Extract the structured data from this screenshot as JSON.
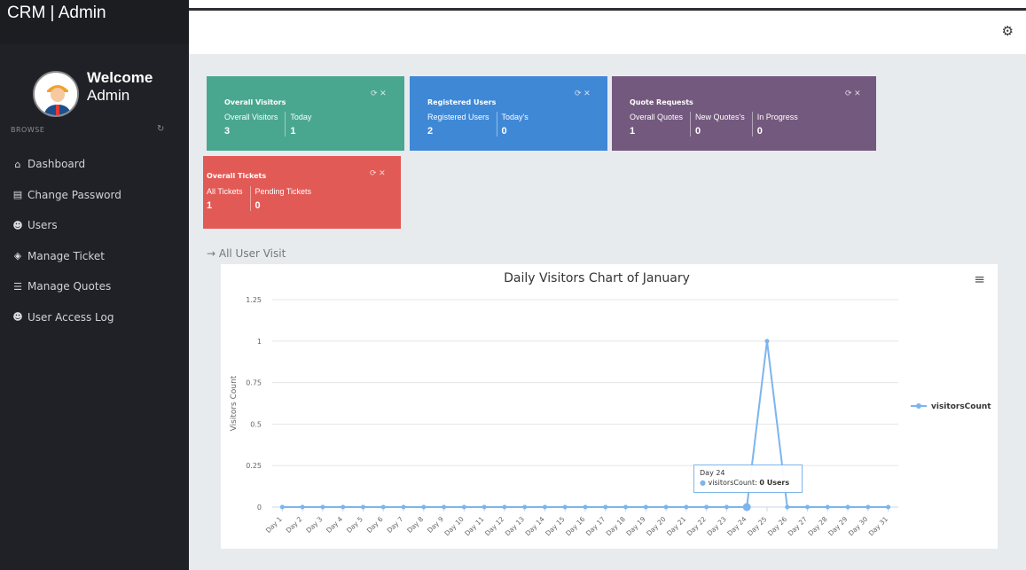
{
  "app": {
    "title": "CRM | Admin"
  },
  "profile": {
    "welcome": "Welcome",
    "name": "Admin"
  },
  "sidebar": {
    "browse": "BROWSE",
    "items": [
      {
        "label": "Dashboard",
        "icon": "home-icon"
      },
      {
        "label": "Change Password",
        "icon": "file-icon"
      },
      {
        "label": "Users",
        "icon": "users-icon"
      },
      {
        "label": "Manage Ticket",
        "icon": "ticket-icon"
      },
      {
        "label": "Manage Quotes",
        "icon": "list-icon"
      },
      {
        "label": "User Access Log",
        "icon": "users-icon"
      }
    ]
  },
  "stats": {
    "visitors": {
      "title": "Overall Visitors",
      "labels": [
        "Overall Visitors",
        "Today"
      ],
      "values": [
        "3",
        "1"
      ],
      "color": "#4aa78f"
    },
    "registered": {
      "title": "Registered Users",
      "labels": [
        "Registered Users",
        "Today's"
      ],
      "values": [
        "2",
        "0"
      ],
      "color": "#3f88d6"
    },
    "quotes": {
      "title": "Quote Requests",
      "labels": [
        "Overall Quotes",
        "New Quotes's",
        "In Progress"
      ],
      "values": [
        "1",
        "0",
        "0"
      ],
      "color": "#74597e"
    },
    "tickets": {
      "title": "Overall Tickets",
      "labels": [
        "All Tickets",
        "Pending Tickets"
      ],
      "values": [
        "1",
        "0"
      ],
      "color": "#e25a56"
    }
  },
  "section": {
    "link": "→ All User Visit"
  },
  "chart_data": {
    "type": "line",
    "title": "Daily Visitors Chart of January",
    "ylabel": "Visitors Count",
    "xlabel": "",
    "ylim": [
      0,
      1.25
    ],
    "yticks": [
      "0",
      "0.25",
      "0.5",
      "0.75",
      "1",
      "1.25"
    ],
    "categories": [
      "Day 1",
      "Day 2",
      "Day 3",
      "Day 4",
      "Day 5",
      "Day 6",
      "Day 7",
      "Day 8",
      "Day 9",
      "Day 10",
      "Day 11",
      "Day 12",
      "Day 13",
      "Day 14",
      "Day 15",
      "Day 16",
      "Day 17",
      "Day 18",
      "Day 19",
      "Day 20",
      "Day 21",
      "Day 22",
      "Day 23",
      "Day 24",
      "Day 25",
      "Day 26",
      "Day 27",
      "Day 28",
      "Day 29",
      "Day 30",
      "Day 31"
    ],
    "series": [
      {
        "name": "visitorsCount",
        "values": [
          0,
          0,
          0,
          0,
          0,
          0,
          0,
          0,
          0,
          0,
          0,
          0,
          0,
          0,
          0,
          0,
          0,
          0,
          0,
          0,
          0,
          0,
          0,
          0,
          1,
          0,
          0,
          0,
          0,
          0,
          0
        ]
      }
    ],
    "legend": "right",
    "grid": true,
    "color": "#7cb5ec"
  },
  "tooltip": {
    "day": "Day 24",
    "series": "visitorsCount",
    "value": "0 Users"
  }
}
